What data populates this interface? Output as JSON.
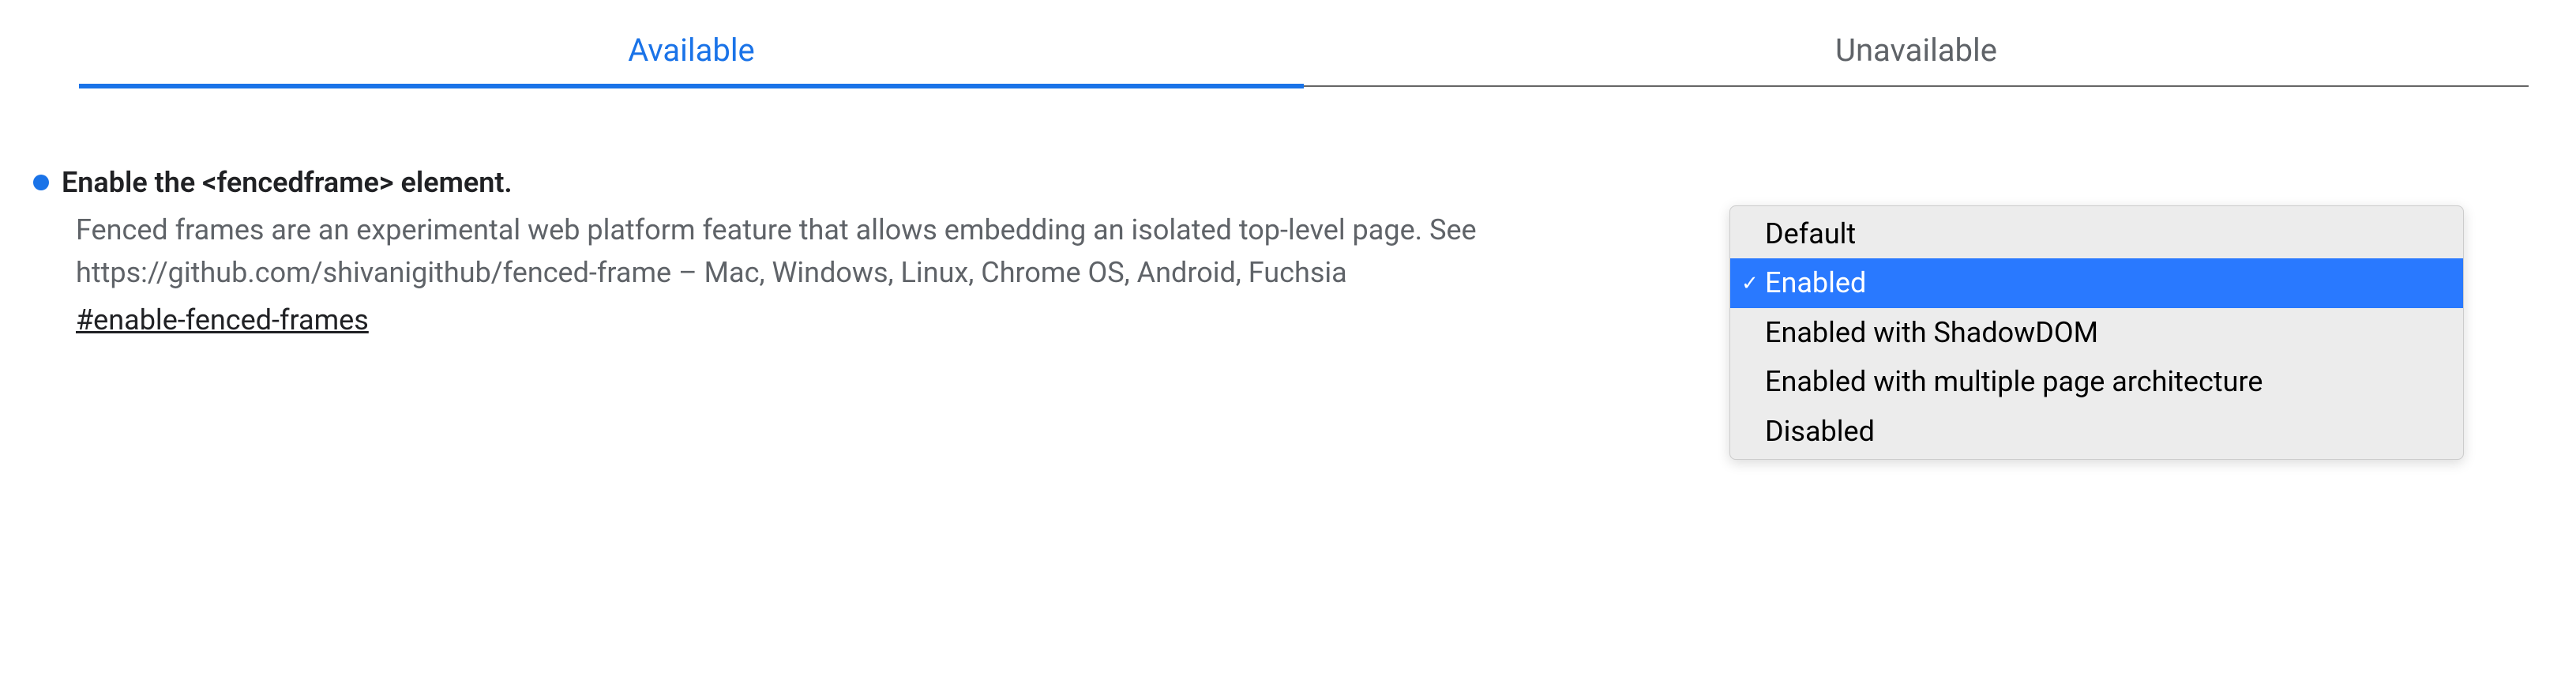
{
  "tabs": {
    "available": "Available",
    "unavailable": "Unavailable"
  },
  "flag": {
    "title": "Enable the <fencedframe> element.",
    "description": "Fenced frames are an experimental web platform feature that allows embedding an isolated top-level page. See https://github.com/shivanigithub/fenced-frame – Mac, Windows, Linux, Chrome OS, Android, Fuchsia",
    "link": "#enable-fenced-frames"
  },
  "dropdown": {
    "options": [
      "Default",
      "Enabled",
      "Enabled with ShadowDOM",
      "Enabled with multiple page architecture",
      "Disabled"
    ],
    "selected_index": 1,
    "checkmark": "✓"
  }
}
